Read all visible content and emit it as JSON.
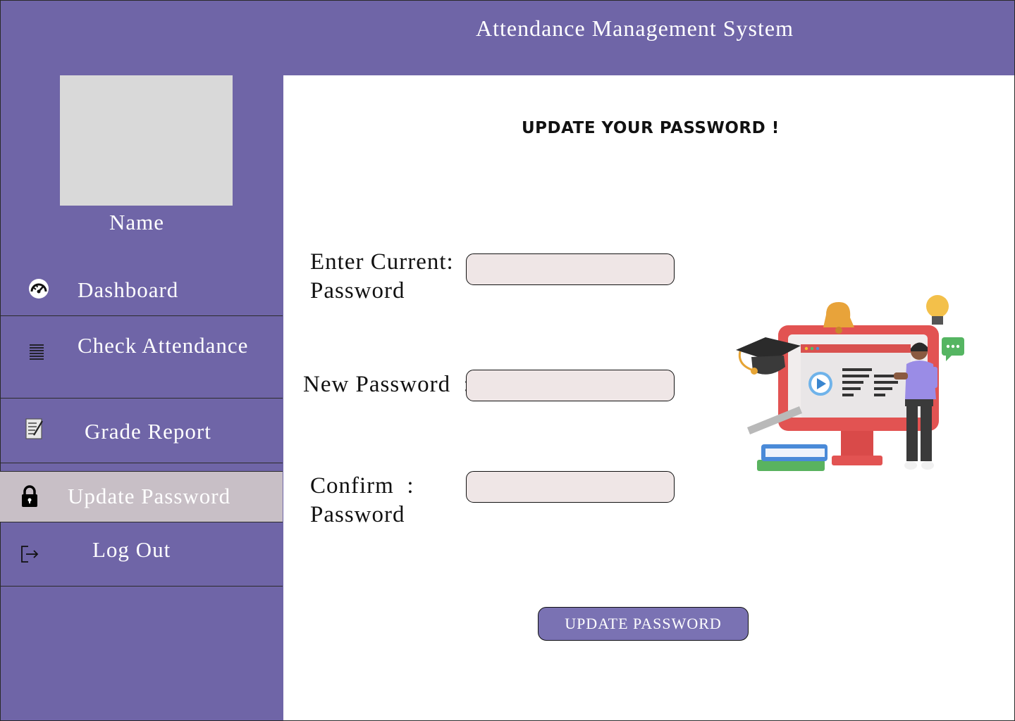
{
  "app": {
    "title": "Attendance Management System"
  },
  "profile": {
    "name": "Name"
  },
  "sidebar": {
    "items": [
      {
        "label": "Dashboard",
        "icon": "dashboard-gauge-icon"
      },
      {
        "label": "Check Attendance",
        "icon": "list-lines-icon"
      },
      {
        "label": "Grade Report",
        "icon": "report-document-icon"
      },
      {
        "label": "Update Password",
        "icon": "lock-icon",
        "active": true
      },
      {
        "label": "Log Out",
        "icon": "logout-icon"
      }
    ]
  },
  "main": {
    "heading": "UPDATE YOUR PASSWORD !",
    "fields": [
      {
        "label": "Enter Current:\nPassword",
        "value": "",
        "placeholder": ""
      },
      {
        "label": "New Password  :",
        "value": "",
        "placeholder": ""
      },
      {
        "label": "Confirm  :\nPassword",
        "value": "",
        "placeholder": ""
      }
    ],
    "submit_label": "UPDATE PASSWORD",
    "illustration": "education-computer-illustration"
  },
  "colors": {
    "background": "#6f65a7",
    "content": "#ffffff",
    "active_item": "#c8bfc6",
    "input_fill": "#efe6e6",
    "button": "#7a72b3"
  }
}
